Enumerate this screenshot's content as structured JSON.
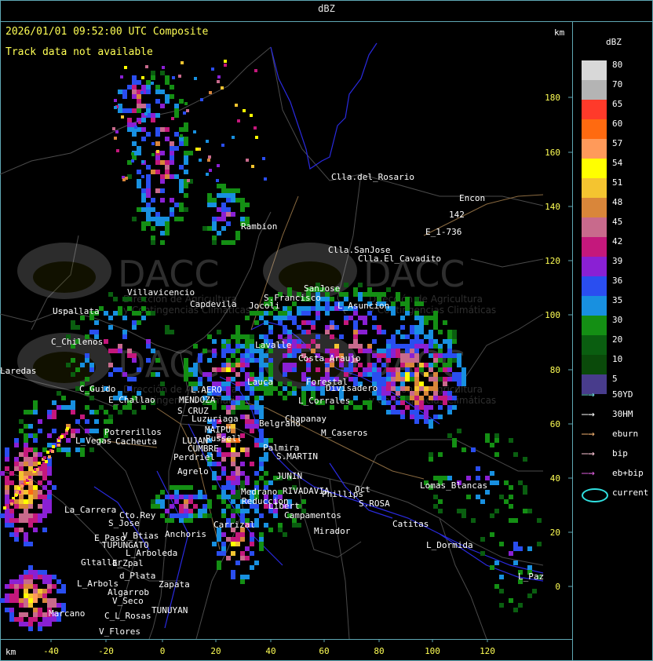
{
  "header": {
    "title": "dBZ",
    "timestamp": "2026/01/01 09:52:00 UTC Composite",
    "track_note": "Track data not available",
    "unit_top": "km",
    "unit_bottom": "km"
  },
  "axes": {
    "x_ticks": [
      "-40",
      "-20",
      "0",
      "20",
      "40",
      "60",
      "80",
      "100",
      "120"
    ],
    "y_ticks": [
      "180",
      "160",
      "140",
      "120",
      "100",
      "80",
      "60",
      "40",
      "20",
      "0"
    ]
  },
  "legend": {
    "title": "dBZ",
    "scale": [
      {
        "label": "80",
        "color": "#d8d8d8"
      },
      {
        "label": "70",
        "color": "#b4b4b4"
      },
      {
        "label": "65",
        "color": "#ff3a2a"
      },
      {
        "label": "60",
        "color": "#ff6a10"
      },
      {
        "label": "57",
        "color": "#ff9a5a"
      },
      {
        "label": "54",
        "color": "#ffff00"
      },
      {
        "label": "51",
        "color": "#f4c430"
      },
      {
        "label": "48",
        "color": "#d9863a"
      },
      {
        "label": "45",
        "color": "#c86a8c"
      },
      {
        "label": "42",
        "color": "#c4187c"
      },
      {
        "label": "39",
        "color": "#8a20d4"
      },
      {
        "label": "36",
        "color": "#2a4ef0"
      },
      {
        "label": "35",
        "color": "#1890e0"
      },
      {
        "label": "30",
        "color": "#148f14"
      },
      {
        "label": "20",
        "color": "#0a5e10"
      },
      {
        "label": "10",
        "color": "#0a4a0a"
      },
      {
        "label": "5",
        "color": "#483c8c"
      }
    ],
    "tracks": [
      {
        "label": "50YD",
        "color": "#6fe0e0"
      },
      {
        "label": "30HM",
        "color": "#ffffff"
      },
      {
        "label": "eburn",
        "color": "#f0b070"
      },
      {
        "label": "bip",
        "color": "#ffc8d8"
      },
      {
        "label": "eb+bip",
        "color": "#e060e0"
      },
      {
        "label": "current",
        "color": "#30e0e0"
      }
    ]
  },
  "places": [
    {
      "name": "Clla.del_Rosario"
    },
    {
      "name": "Encon"
    },
    {
      "name": "E_1-736"
    },
    {
      "name": "142"
    },
    {
      "name": "Rambion"
    },
    {
      "name": "Clla.SanJose"
    },
    {
      "name": "Clla.El_Cavadito"
    },
    {
      "name": "SanJose"
    },
    {
      "name": "Villavicencio"
    },
    {
      "name": "Capdevila"
    },
    {
      "name": "S.Francisco"
    },
    {
      "name": "L_Asuncion"
    },
    {
      "name": "Uspallata"
    },
    {
      "name": "C_Chilenos"
    },
    {
      "name": "Laredas"
    },
    {
      "name": "C_Guido"
    },
    {
      "name": "E_Challao"
    },
    {
      "name": "MENDOZA"
    },
    {
      "name": "L.AERO"
    },
    {
      "name": "S_CRUZ"
    },
    {
      "name": "Luzuriaga"
    },
    {
      "name": "MAIPU"
    },
    {
      "name": "Russell"
    },
    {
      "name": "CUMBRE"
    },
    {
      "name": "LUJAN"
    },
    {
      "name": "Perdriel"
    },
    {
      "name": "Agrelo"
    },
    {
      "name": "Potrerillos"
    },
    {
      "name": "L_Vegas"
    },
    {
      "name": "Cacheuta"
    },
    {
      "name": "S.MARTIN"
    },
    {
      "name": "JUNIN"
    },
    {
      "name": "RIVADAVIA"
    },
    {
      "name": "Chapanay"
    },
    {
      "name": "M_Caseros"
    },
    {
      "name": "Divisadero"
    },
    {
      "name": "L_Corrales"
    },
    {
      "name": "Lomas_Blancas"
    },
    {
      "name": "L_Paz"
    },
    {
      "name": "L_Dormida"
    },
    {
      "name": "Catitas"
    },
    {
      "name": "S.ROSA"
    },
    {
      "name": "Phillips"
    },
    {
      "name": "Oct"
    },
    {
      "name": "Mirador"
    },
    {
      "name": "Campamentos"
    },
    {
      "name": "Libert"
    },
    {
      "name": "Medrano"
    },
    {
      "name": "Reduccion"
    },
    {
      "name": "Carrizal"
    },
    {
      "name": "Anchoris"
    },
    {
      "name": "La_Carrera"
    },
    {
      "name": "Cto.Rey"
    },
    {
      "name": "S_Jose"
    },
    {
      "name": "E_Paso"
    },
    {
      "name": "V_Btias"
    },
    {
      "name": "TUPUNGATO"
    },
    {
      "name": "L_Arboleda"
    },
    {
      "name": "Gltallar"
    },
    {
      "name": "E_Zpal"
    },
    {
      "name": "L_Arbols"
    },
    {
      "name": "d_Plata"
    },
    {
      "name": "Algarrob"
    },
    {
      "name": "V_Seco"
    },
    {
      "name": "Zapata"
    },
    {
      "name": "TUNUYAN"
    },
    {
      "name": "Marcano"
    },
    {
      "name": "C_L_Rosas"
    },
    {
      "name": "V_Flores"
    },
    {
      "name": "Lavalle"
    },
    {
      "name": "Jocoli"
    },
    {
      "name": "Costa_Araujo"
    },
    {
      "name": "Belgrano"
    },
    {
      "name": "Palmira"
    },
    {
      "name": "Lauca"
    },
    {
      "name": "Forestal"
    }
  ],
  "watermarks": [
    {
      "brand": "DACC",
      "line1": "Dirección de Agricultura",
      "line2": "y Contingencias Climáticas"
    },
    {
      "brand": "DACC",
      "line1": "Dirección de Agricultura",
      "line2": "y Contingencias Climáticas"
    },
    {
      "brand": "DACC",
      "line1": "Dirección de Agricultura",
      "line2": "y Contingencias Climáticas"
    },
    {
      "brand": "DACC",
      "line1": "Dirección de Agricultura",
      "line2": "y Contingencias Climáticas"
    }
  ]
}
